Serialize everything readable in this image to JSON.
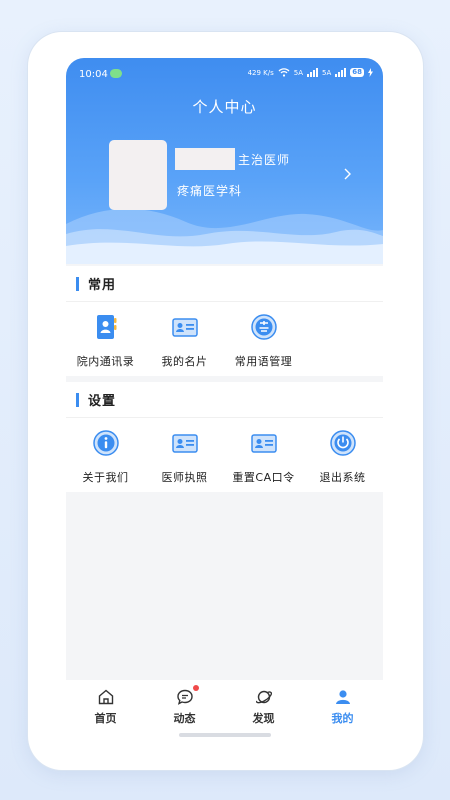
{
  "status_bar": {
    "time": "10:04",
    "net_speed": "429 K/s",
    "signal_1_label": "5A",
    "signal_2_label": "5A",
    "battery": "68"
  },
  "header": {
    "title": "个人中心",
    "doctor_title": "主治医师",
    "department": "疼痛医学科"
  },
  "common_section": {
    "title": "常用",
    "items": [
      {
        "label": "院内通讯录",
        "icon": "contacts-book-icon"
      },
      {
        "label": "我的名片",
        "icon": "id-card-icon"
      },
      {
        "label": "常用语管理",
        "icon": "common-phrase-icon"
      }
    ]
  },
  "settings_section": {
    "title": "设置",
    "items": [
      {
        "label": "关于我们",
        "icon": "info-icon"
      },
      {
        "label": "医师执照",
        "icon": "license-card-icon"
      },
      {
        "label": "重置CA口令",
        "icon": "ca-card-icon"
      },
      {
        "label": "退出系统",
        "icon": "power-icon"
      }
    ]
  },
  "tab_bar": {
    "tabs": [
      {
        "label": "首页",
        "icon": "home-icon"
      },
      {
        "label": "动态",
        "icon": "message-icon"
      },
      {
        "label": "发现",
        "icon": "planet-icon"
      },
      {
        "label": "我的",
        "icon": "user-icon"
      }
    ],
    "active_index": 3
  },
  "colors": {
    "accent": "#3b8df0",
    "badge": "#f04a4a"
  }
}
